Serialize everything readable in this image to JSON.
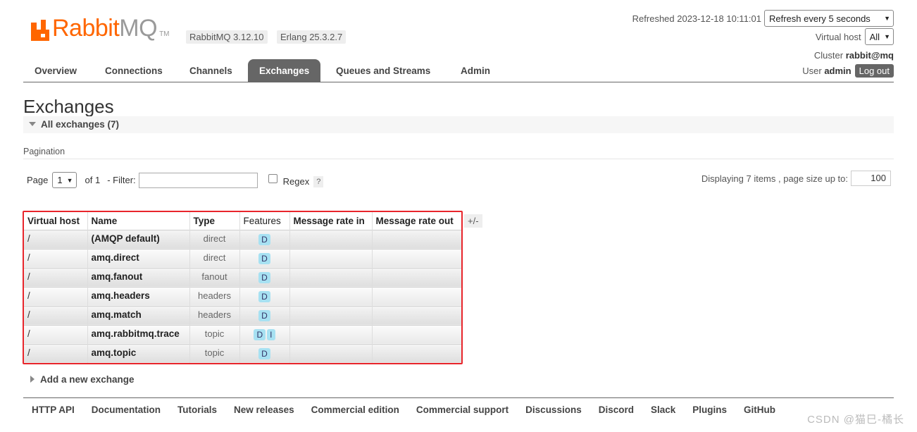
{
  "header": {
    "logo_orange": "Rabbit",
    "logo_gray": "MQ",
    "logo_tm": "TM",
    "version": "RabbitMQ 3.12.10",
    "erlang": "Erlang 25.3.2.7",
    "refreshed": "Refreshed 2023-12-18 10:11:01",
    "refresh_option": "Refresh every 5 seconds",
    "vhost_label": "Virtual host",
    "vhost_value": "All",
    "cluster_label": "Cluster",
    "cluster_value": "rabbit@mq",
    "user_label": "User",
    "user_value": "admin",
    "logout": "Log out"
  },
  "nav": {
    "tabs": [
      "Overview",
      "Connections",
      "Channels",
      "Exchanges",
      "Queues and Streams",
      "Admin"
    ],
    "active": "Exchanges"
  },
  "page": {
    "title": "Exchanges",
    "section": "All exchanges (7)",
    "pagination_label": "Pagination",
    "page_label": "Page",
    "page_value": "1",
    "of_label": "of 1",
    "filter_label": "- Filter:",
    "regex_label": "Regex",
    "help": "?",
    "displaying": "Displaying 7 items , page size up to:",
    "page_size": "100"
  },
  "table": {
    "headers": [
      "Virtual host",
      "Name",
      "Type",
      "Features",
      "Message rate in",
      "Message rate out"
    ],
    "plus_minus": "+/-",
    "rows": [
      {
        "vhost": "/",
        "name": "(AMQP default)",
        "type": "direct",
        "features": [
          "D"
        ],
        "rate_in": "",
        "rate_out": ""
      },
      {
        "vhost": "/",
        "name": "amq.direct",
        "type": "direct",
        "features": [
          "D"
        ],
        "rate_in": "",
        "rate_out": ""
      },
      {
        "vhost": "/",
        "name": "amq.fanout",
        "type": "fanout",
        "features": [
          "D"
        ],
        "rate_in": "",
        "rate_out": ""
      },
      {
        "vhost": "/",
        "name": "amq.headers",
        "type": "headers",
        "features": [
          "D"
        ],
        "rate_in": "",
        "rate_out": ""
      },
      {
        "vhost": "/",
        "name": "amq.match",
        "type": "headers",
        "features": [
          "D"
        ],
        "rate_in": "",
        "rate_out": ""
      },
      {
        "vhost": "/",
        "name": "amq.rabbitmq.trace",
        "type": "topic",
        "features": [
          "D",
          "I"
        ],
        "rate_in": "",
        "rate_out": ""
      },
      {
        "vhost": "/",
        "name": "amq.topic",
        "type": "topic",
        "features": [
          "D"
        ],
        "rate_in": "",
        "rate_out": ""
      }
    ]
  },
  "add_exchange": "Add a new exchange",
  "footer": {
    "links": [
      "HTTP API",
      "Documentation",
      "Tutorials",
      "New releases",
      "Commercial edition",
      "Commercial support",
      "Discussions",
      "Discord",
      "Slack",
      "Plugins",
      "GitHub"
    ]
  },
  "watermark": "CSDN @猫巳-橘长"
}
